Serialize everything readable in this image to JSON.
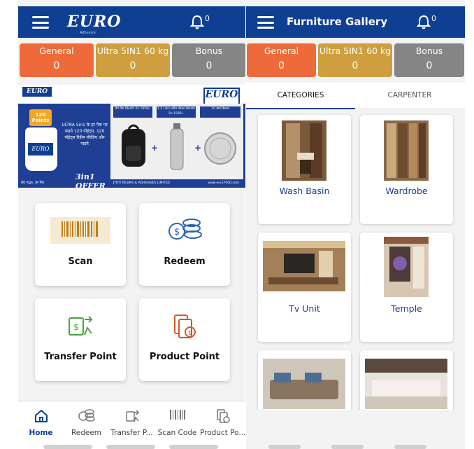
{
  "left": {
    "header": {
      "logo": "EURO",
      "logo_sub": "Adhesive",
      "bell_count": "0"
    },
    "points": [
      {
        "label": "General",
        "value": "0"
      },
      {
        "label": "Ultra 5IN1 60 kg",
        "value": "0"
      },
      {
        "label": "Bonus",
        "value": "0"
      }
    ],
    "banner": {
      "brand": "EURO",
      "badge": "120 Points",
      "bucket_label": "EURO",
      "hindi_text": "ULTRA 5in1 के हर पैक पर पाइये 120 पॉइंट्स, 120 पॉइंट्स रिडीम कीजिए और पाइये",
      "offer": "3in1 OFFER",
      "kgs": "60 Kgs. हर पैक",
      "gift_1": "बैग पैक Worth Rs 1950/-",
      "gift_2": "1.5 Litre स्टील बोतल Worth Rs 1595/-",
      "gift_3": "10 ग्राम सिल्वर",
      "footer_left": "JYOTI RESINS & ADHESIVES LIMITED",
      "footer_right": "www.euro7000.com"
    },
    "tiles": [
      {
        "label": "Scan",
        "icon": "barcode-icon"
      },
      {
        "label": "Redeem",
        "icon": "coins-icon"
      },
      {
        "label": "Transfer Point",
        "icon": "transfer-icon"
      },
      {
        "label": "Product Point",
        "icon": "product-icon"
      }
    ],
    "nav": [
      {
        "label": "Home",
        "icon": "home-icon"
      },
      {
        "label": "Redeem",
        "icon": "coins-icon"
      },
      {
        "label": "Transfer P...",
        "icon": "transfer-icon"
      },
      {
        "label": "Scan Code",
        "icon": "barcode-icon"
      },
      {
        "label": "Product Po...",
        "icon": "product-icon"
      }
    ]
  },
  "right": {
    "header": {
      "title": "Furniture Gallery",
      "bell_count": "0"
    },
    "points": [
      {
        "label": "General",
        "value": "0"
      },
      {
        "label": "Ultra 5IN1 60 kg",
        "value": "0"
      },
      {
        "label": "Bonus",
        "value": "0"
      }
    ],
    "tabs": [
      "CATEGORIES",
      "CARPENTER"
    ],
    "categories": [
      {
        "label": "Wash Basin"
      },
      {
        "label": "Wardrobe"
      },
      {
        "label": "Tv Unit"
      },
      {
        "label": "Temple"
      },
      {
        "label": ""
      },
      {
        "label": ""
      }
    ]
  },
  "colors": {
    "brand_blue": "#0e3f93",
    "general": "#ee6a3a",
    "ultra": "#cf9e3e",
    "bonus": "#858585"
  }
}
